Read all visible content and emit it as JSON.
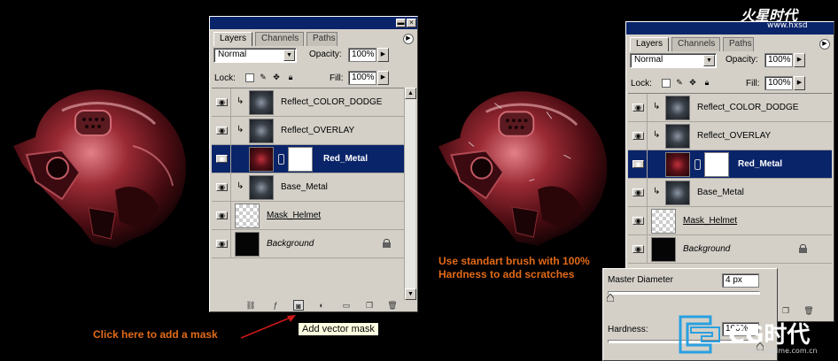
{
  "panel": {
    "tabs": [
      "Layers",
      "Channels",
      "Paths"
    ],
    "blend_mode": "Normal",
    "opacity_label": "Opacity:",
    "opacity_value": "100%",
    "lock_label": "Lock:",
    "fill_label": "Fill:",
    "fill_value": "100%",
    "layers": [
      {
        "name": "Reflect_COLOR_DODGE",
        "clipped": true,
        "thumb": "metal"
      },
      {
        "name": "Reflect_OVERLAY",
        "clipped": true,
        "thumb": "metal"
      },
      {
        "name": "Red_Metal",
        "clipped": false,
        "thumb": "red",
        "mask": true,
        "selected": true
      },
      {
        "name": "Base_Metal",
        "clipped": true,
        "thumb": "metal"
      },
      {
        "name": "Mask_Helmet",
        "clipped": false,
        "thumb": "checker",
        "underline": true
      },
      {
        "name": "Background",
        "clipped": false,
        "thumb": "black",
        "italic": true,
        "locked": true
      }
    ]
  },
  "tooltip": "Add vector mask",
  "annotations": {
    "add_mask": "Click here to add a mask",
    "brush_line1": "Use standart brush with 100%",
    "brush_line2": "Hardness to add scratches"
  },
  "brush_popup": {
    "diameter_label": "Master Diameter",
    "diameter_value": "4 px",
    "hardness_label": "Hardness:",
    "hardness_value": "100%"
  },
  "watermarks": {
    "top_logo": "火星时代",
    "top_url": "www.hxsd",
    "bottom_logo": "CG时代",
    "bottom_url": "www.cgtime.com.cn"
  },
  "colors": {
    "selection": "#0a246a",
    "annotation": "#e26a18",
    "panel_bg": "#d4d0c8"
  }
}
